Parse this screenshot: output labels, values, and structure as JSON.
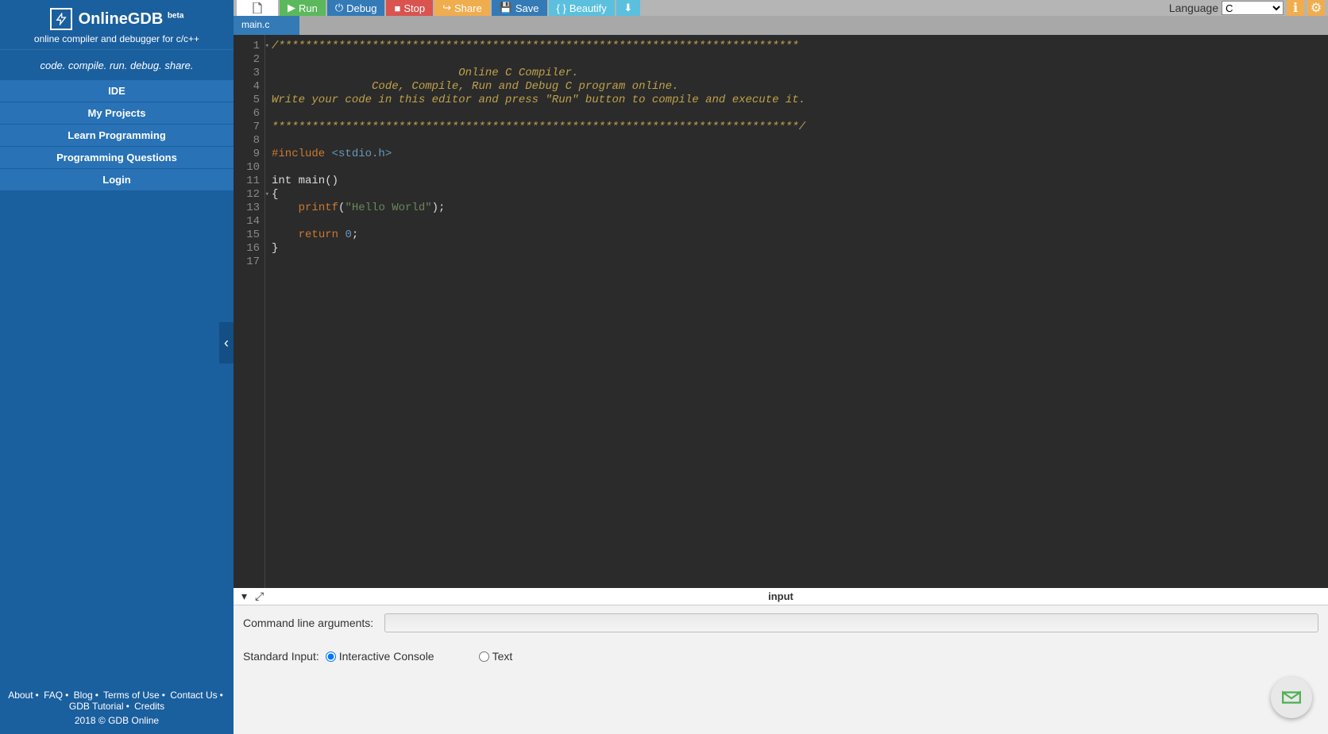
{
  "sidebar": {
    "title": "OnlineGDB",
    "badge": "beta",
    "subtitle": "online compiler and debugger for c/c++",
    "tagline": "code. compile. run. debug. share.",
    "nav": [
      "IDE",
      "My Projects",
      "Learn Programming",
      "Programming Questions",
      "Login"
    ],
    "footer_links": [
      "About",
      "FAQ",
      "Blog",
      "Terms of Use",
      "Contact Us",
      "GDB Tutorial",
      "Credits"
    ],
    "copyright": "2018 © GDB Online"
  },
  "toolbar": {
    "run": "Run",
    "debug": "Debug",
    "stop": "Stop",
    "share": "Share",
    "save": "Save",
    "beautify": "Beautify",
    "language_label": "Language",
    "language_value": "C"
  },
  "tabs": [
    "main.c"
  ],
  "code": {
    "lines": [
      {
        "n": 1,
        "fold": true,
        "type": "comment",
        "text": "/******************************************************************************"
      },
      {
        "n": 2,
        "type": "comment",
        "text": ""
      },
      {
        "n": 3,
        "type": "comment",
        "text": "                            Online C Compiler."
      },
      {
        "n": 4,
        "type": "comment",
        "text": "               Code, Compile, Run and Debug C program online."
      },
      {
        "n": 5,
        "type": "comment",
        "text": "Write your code in this editor and press \"Run\" button to compile and execute it."
      },
      {
        "n": 6,
        "type": "comment",
        "text": ""
      },
      {
        "n": 7,
        "type": "comment",
        "text": "*******************************************************************************/"
      },
      {
        "n": 8,
        "type": "plain",
        "text": ""
      },
      {
        "n": 9,
        "type": "include",
        "text": "#include <stdio.h>"
      },
      {
        "n": 10,
        "type": "plain",
        "text": ""
      },
      {
        "n": 11,
        "type": "plain",
        "text": "int main()"
      },
      {
        "n": 12,
        "fold": true,
        "type": "plain",
        "text": "{"
      },
      {
        "n": 13,
        "type": "printf",
        "text": "    printf(\"Hello World\");"
      },
      {
        "n": 14,
        "type": "plain",
        "text": ""
      },
      {
        "n": 15,
        "type": "return",
        "text": "    return 0;"
      },
      {
        "n": 16,
        "type": "plain",
        "text": "}"
      },
      {
        "n": 17,
        "type": "plain",
        "text": ""
      }
    ]
  },
  "bottom": {
    "title": "input",
    "cmd_label": "Command line arguments:",
    "cmd_value": "",
    "stdin_label": "Standard Input:",
    "opt_interactive": "Interactive Console",
    "opt_text": "Text"
  }
}
